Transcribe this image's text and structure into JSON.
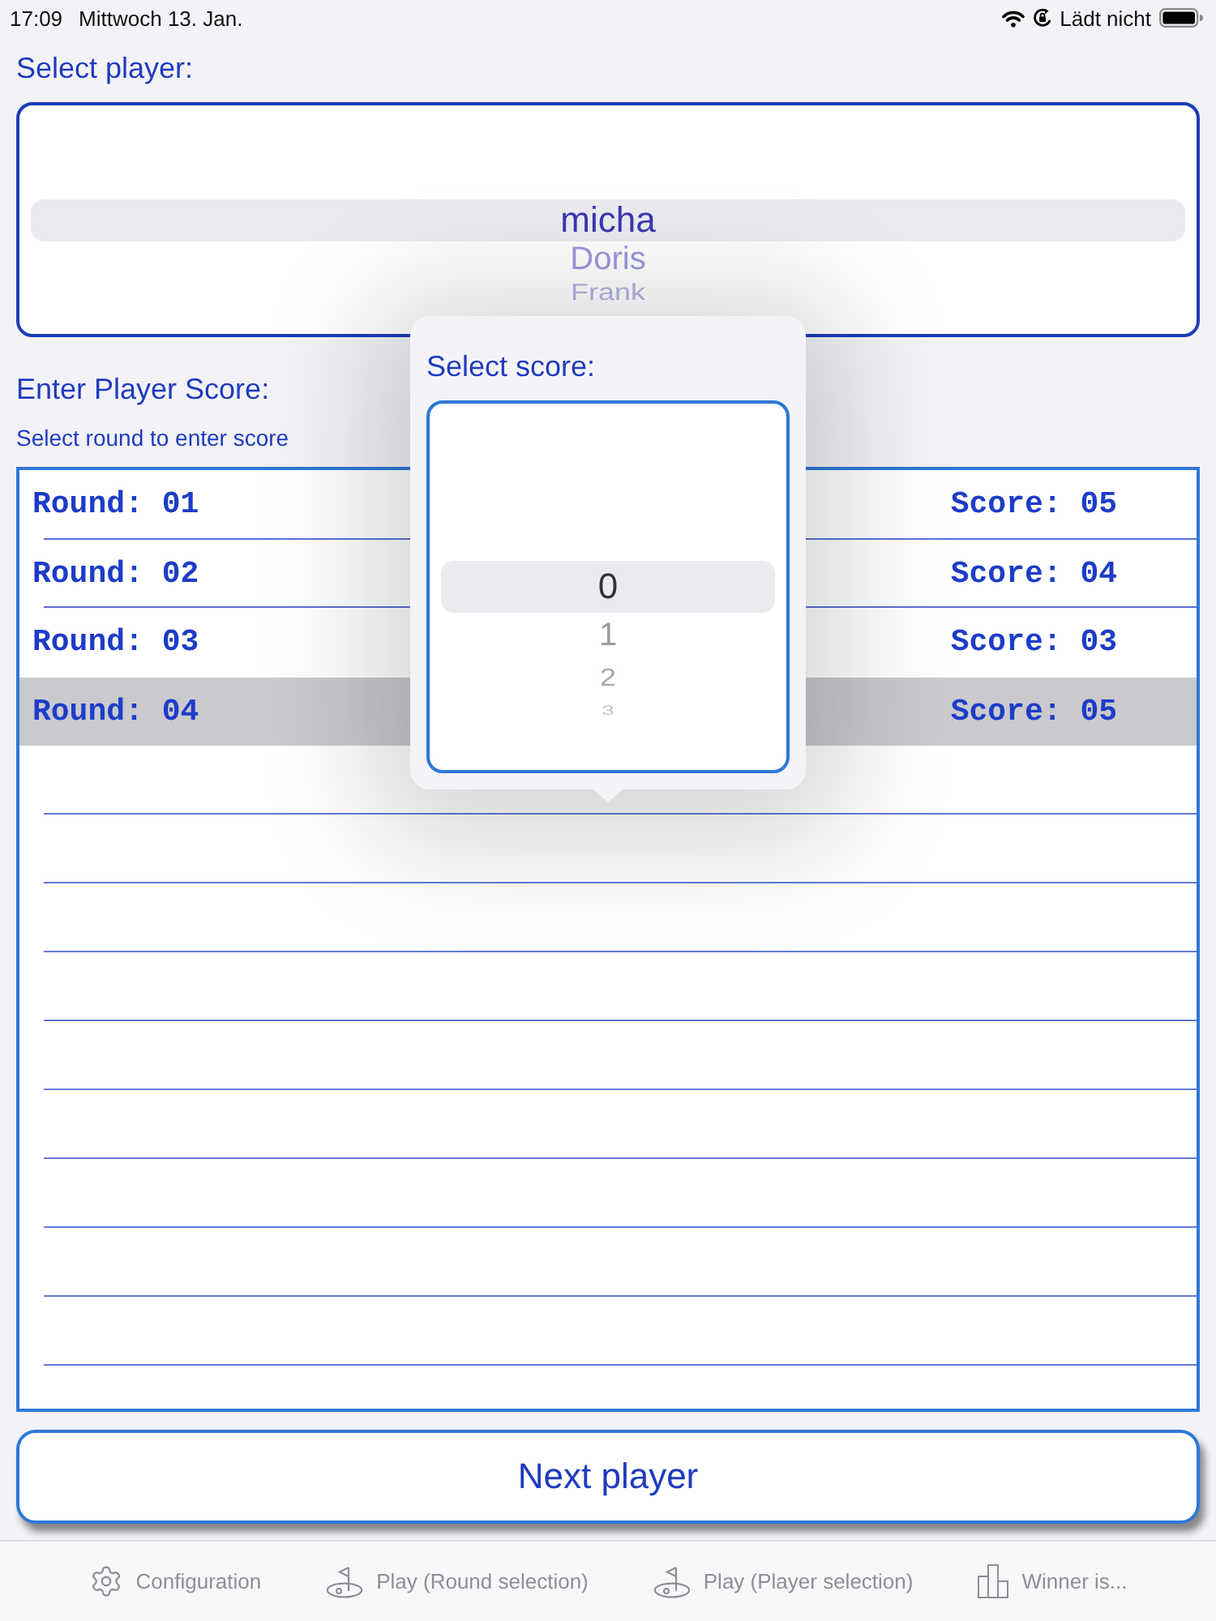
{
  "status_bar": {
    "time": "17:09",
    "date": "Mittwoch 13. Jan.",
    "charging": "Lädt nicht"
  },
  "player_section": {
    "title": "Select player:",
    "picker": {
      "items": [
        {
          "label": "micha",
          "selected": true
        },
        {
          "label": "Doris",
          "selected": false
        },
        {
          "label": "Frank",
          "selected": false
        }
      ]
    }
  },
  "score_section": {
    "title": "Enter Player Score:",
    "hint": "Select round to enter score"
  },
  "rounds_table": {
    "rows": [
      {
        "round": "Round: 01",
        "score": "Score: 05",
        "selected": false
      },
      {
        "round": "Round: 02",
        "score": "Score: 04",
        "selected": false
      },
      {
        "round": "Round: 03",
        "score": "Score: 03",
        "selected": false
      },
      {
        "round": "Round: 04",
        "score": "Score: 05",
        "selected": true
      }
    ]
  },
  "score_popover": {
    "title": "Select score:",
    "picker": {
      "items": [
        {
          "label": "0",
          "selected": true
        },
        {
          "label": "1",
          "selected": false
        },
        {
          "label": "2",
          "selected": false
        },
        {
          "label": "3",
          "selected": false
        }
      ]
    }
  },
  "next_button": {
    "label": "Next player"
  },
  "tab_bar": {
    "items": [
      {
        "label": "Configuration",
        "kind": "settings",
        "selected": false
      },
      {
        "label": "Play (Round selection)",
        "kind": "play",
        "selected": false
      },
      {
        "label": "Play (Player selection)",
        "kind": "play",
        "selected": false
      },
      {
        "label": "Winner is...",
        "kind": "ranking",
        "selected": false
      }
    ]
  }
}
